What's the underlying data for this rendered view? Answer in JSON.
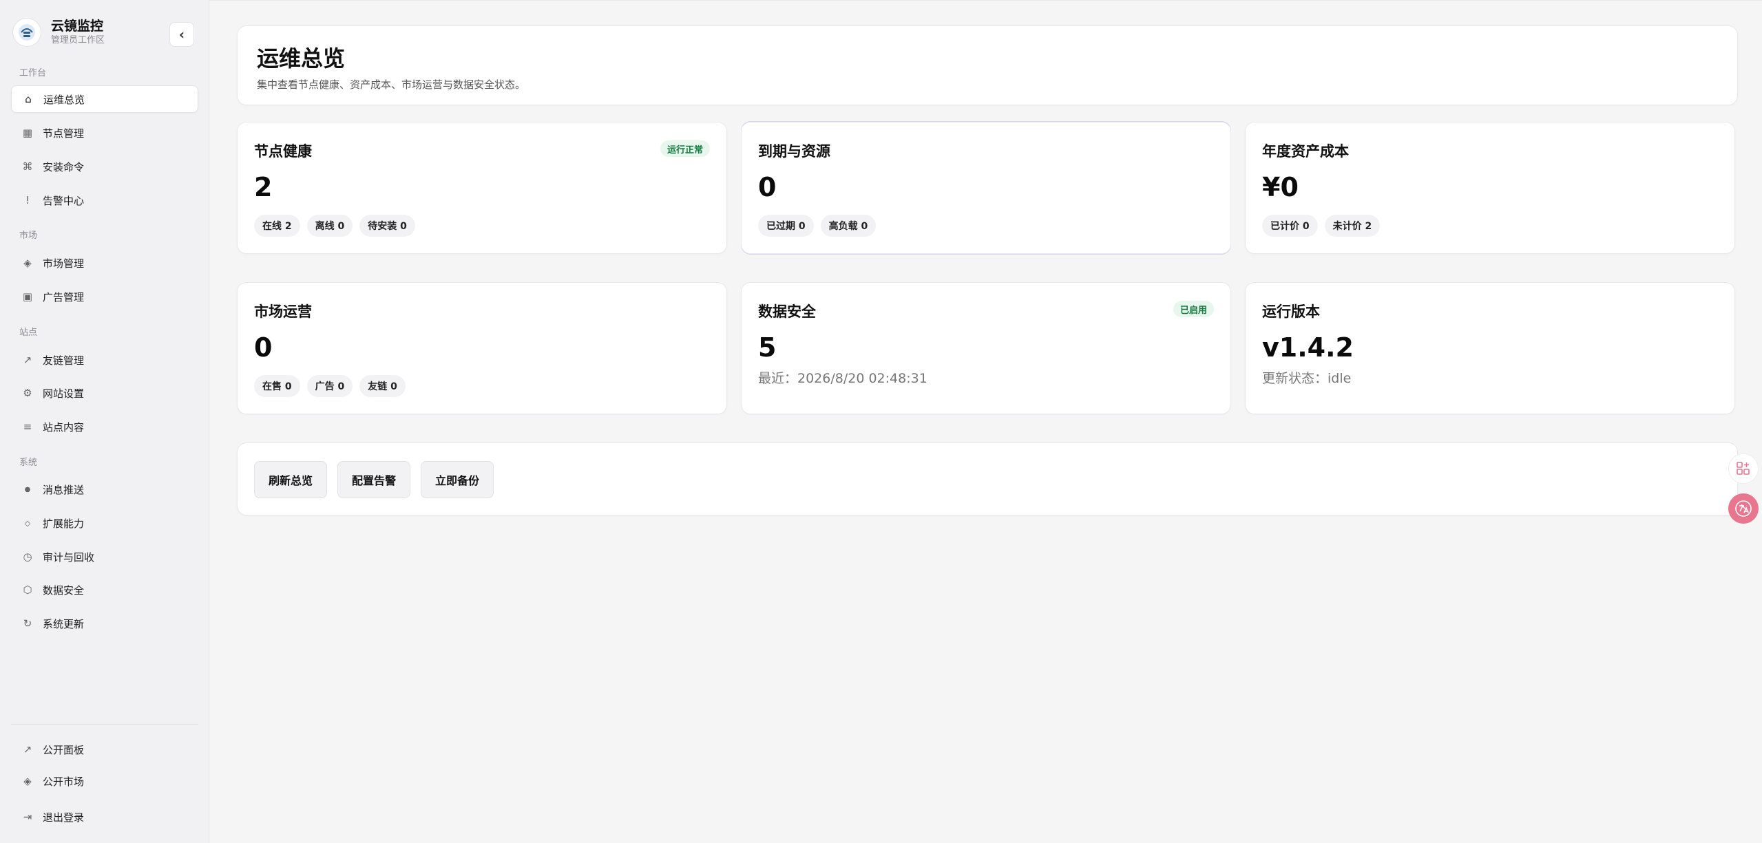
{
  "brand": {
    "title": "云镜监控",
    "subtitle": "管理员工作区",
    "collapse_icon": "chevron-left-icon"
  },
  "sidebar": {
    "sections": [
      "工作台",
      "市场",
      "站点",
      "系统"
    ],
    "items": [
      {
        "label": "运维总览",
        "icon": "home-icon",
        "glyph": "⌂",
        "active": true
      },
      {
        "label": "节点管理",
        "icon": "grid-icon",
        "glyph": "▦"
      },
      {
        "label": "安装命令",
        "icon": "command-icon",
        "glyph": "⌘"
      },
      {
        "label": "告警中心",
        "icon": "alert-icon",
        "glyph": "!"
      },
      {
        "label": "市场管理",
        "icon": "diamond-icon",
        "glyph": "◈"
      },
      {
        "label": "广告管理",
        "icon": "square-icon",
        "glyph": "▣"
      },
      {
        "label": "友链管理",
        "icon": "link-arrow-icon",
        "glyph": "↗"
      },
      {
        "label": "网站设置",
        "icon": "gear-icon",
        "glyph": "⚙"
      },
      {
        "label": "站点内容",
        "icon": "list-icon",
        "glyph": "≡"
      },
      {
        "label": "消息推送",
        "icon": "dot-icon",
        "glyph": "●"
      },
      {
        "label": "扩展能力",
        "icon": "sparkle-icon",
        "glyph": "◇"
      },
      {
        "label": "审计与回收",
        "icon": "clock-icon",
        "glyph": "◷"
      },
      {
        "label": "数据安全",
        "icon": "shield-icon",
        "glyph": "⬡"
      },
      {
        "label": "系统更新",
        "icon": "refresh-icon",
        "glyph": "↻"
      }
    ],
    "bottom_items": [
      {
        "label": "公开面板",
        "icon": "external-icon",
        "glyph": "↗"
      },
      {
        "label": "公开市场",
        "icon": "market-icon",
        "glyph": "◈"
      },
      {
        "label": "退出登录",
        "icon": "logout-icon",
        "glyph": "⇥"
      }
    ]
  },
  "header": {
    "title": "运维总览",
    "description": "集中查看节点健康、资产成本、市场运营与数据安全状态。"
  },
  "cards": {
    "node_health": {
      "title": "节点健康",
      "badge": "运行正常",
      "value": "2",
      "chips": [
        "在线 2",
        "离线 0",
        "待安装 0"
      ]
    },
    "expiry": {
      "title": "到期与资源",
      "value": "0",
      "chips": [
        "已过期 0",
        "高负载 0"
      ]
    },
    "cost": {
      "title": "年度资产成本",
      "value": "¥0",
      "chips": [
        "已计价 0",
        "未计价 2"
      ]
    },
    "market": {
      "title": "市场运营",
      "value": "0",
      "chips": [
        "在售 0",
        "广告 0",
        "友链 0"
      ]
    },
    "security": {
      "title": "数据安全",
      "badge": "已启用",
      "value": "5",
      "sub": "最近：2026/8/20 02:48:31"
    },
    "version": {
      "title": "运行版本",
      "value": "v1.4.2",
      "sub": "更新状态：idle"
    }
  },
  "actions": {
    "refresh": "刷新总览",
    "alerts": "配置告警",
    "backup": "立即备份"
  },
  "colors": {
    "badge_bg": "#e8f7ee",
    "badge_text": "#127a3e",
    "float_pink": "#e8768f"
  }
}
